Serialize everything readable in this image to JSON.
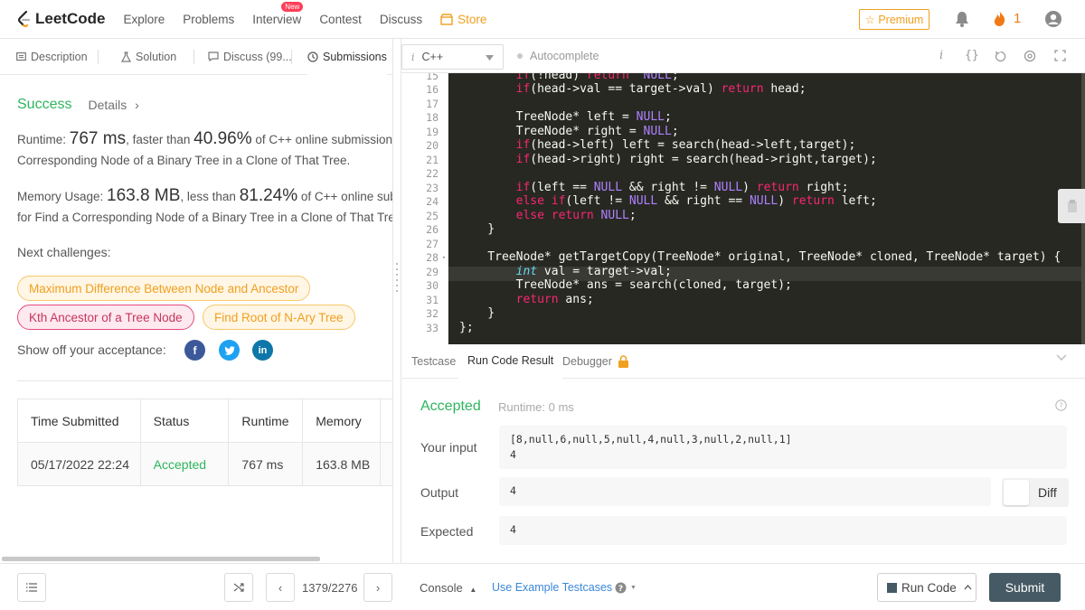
{
  "nav": {
    "logo": "LeetCode",
    "items": [
      "Explore",
      "Problems",
      "Interview",
      "Contest",
      "Discuss"
    ],
    "new_badge": "New",
    "store": "Store",
    "premium": "☆ Premium",
    "streak": "1"
  },
  "tabs": {
    "description": "Description",
    "solution": "Solution",
    "discuss": "Discuss (99...",
    "submissions": "Submissions"
  },
  "result": {
    "status": "Success",
    "details": "Details",
    "runtime_label": "Runtime:",
    "runtime_value": "767 ms",
    "runtime_mid": ", faster than",
    "runtime_pct": "40.96%",
    "runtime_tail": "of C++ online submission",
    "runtime_line2": "Corresponding Node of a Binary Tree in a Clone of That Tree.",
    "memory_label": "Memory Usage:",
    "memory_value": "163.8 MB",
    "memory_mid": ", less than",
    "memory_pct": "81.24%",
    "memory_tail": "of C++ online sub",
    "memory_line2": "for Find a Corresponding Node of a Binary Tree in a Clone of That Tre",
    "next_label": "Next challenges:",
    "challenges": [
      "Maximum Difference Between Node and Ancestor",
      "Kth Ancestor of a Tree Node",
      "Find Root of N-Ary Tree"
    ],
    "showoff": "Show off your acceptance:"
  },
  "submissions_table": {
    "headers": [
      "Time Submitted",
      "Status",
      "Runtime",
      "Memory"
    ],
    "rows": [
      [
        "05/17/2022 22:24",
        "Accepted",
        "767 ms",
        "163.8 MB"
      ]
    ]
  },
  "editor": {
    "language": "C++",
    "lang_icon": "i",
    "autocomplete": "Autocomplete",
    "line_numbers": [
      "15",
      "16",
      "17",
      "18",
      "19",
      "20",
      "21",
      "22",
      "23",
      "24",
      "25",
      "26",
      "27",
      "28",
      "29",
      "30",
      "31",
      "32",
      "33"
    ]
  },
  "result_panel": {
    "tabs": [
      "Testcase",
      "Run Code Result",
      "Debugger"
    ],
    "status": "Accepted",
    "runtime": "Runtime: 0 ms",
    "input_label": "Your input",
    "input_line1": "[8,null,6,null,5,null,4,null,3,null,2,null,1]",
    "input_line2": "4",
    "output_label": "Output",
    "output_value": "4",
    "expected_label": "Expected",
    "expected_value": "4",
    "diff_label": "Diff"
  },
  "bottom": {
    "page": "1379/2276",
    "console": "Console",
    "example": "Use Example Testcases",
    "run_code": "Run Code",
    "submit": "Submit"
  },
  "colors": {
    "accent_green": "#2db55d",
    "premium_orange": "#f0a020",
    "submit_bg": "#455a64",
    "editor_bg": "#272822"
  }
}
